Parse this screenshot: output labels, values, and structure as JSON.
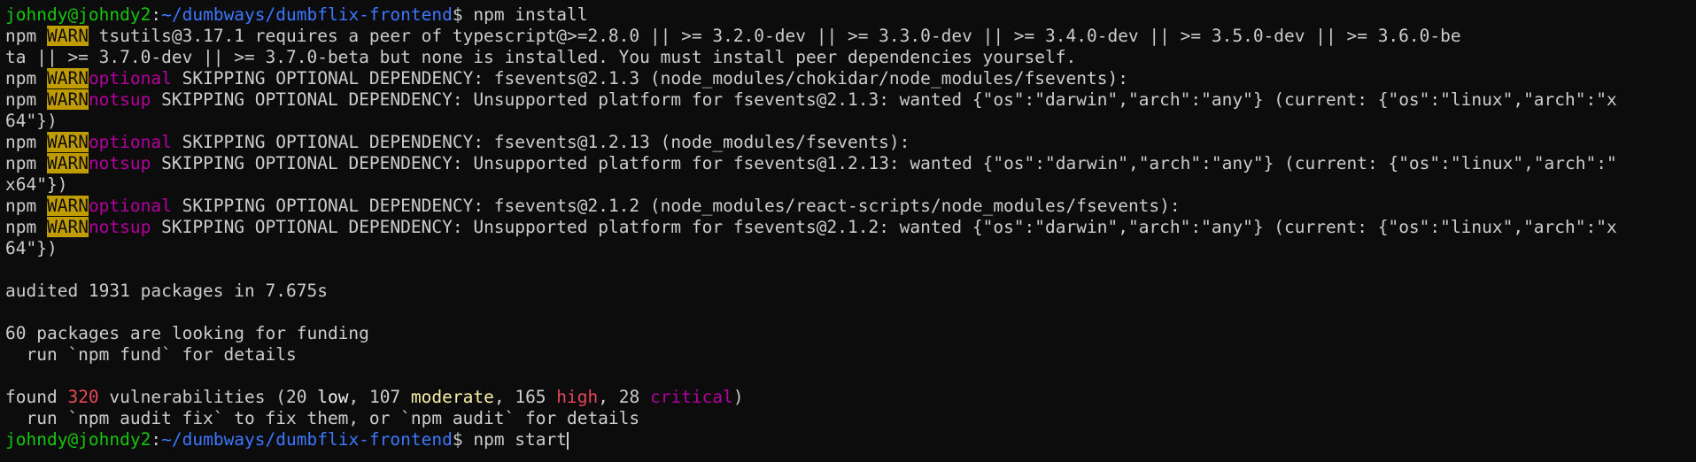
{
  "colors": {
    "background": "#0c0c0c",
    "foreground": "#cccccc",
    "prompt_user": "#16c60c",
    "prompt_path": "#3b78ff",
    "warn_badge_bg": "#c19c00",
    "warn_badge_fg": "#0c0c0c",
    "magenta": "#b4009e",
    "red": "#e74856",
    "yellow": "#f9f1a5"
  },
  "prompt": {
    "user_host": "johndy@johndy2",
    "sep": ":",
    "path": "~/dumbways/dumbflix-frontend",
    "symbol": "$ "
  },
  "commands": {
    "install": "npm install",
    "start": "npm start"
  },
  "npm_label": "npm ",
  "warn_label": "WARN",
  "peer_warn": {
    "line1": " tsutils@3.17.1 requires a peer of typescript@>=2.8.0 || >= 3.2.0-dev || >= 3.3.0-dev || >= 3.4.0-dev || >= 3.5.0-dev || >= 3.6.0-be",
    "line2": "ta || >= 3.7.0-dev || >= 3.7.0-beta but none is installed. You must install peer dependencies yourself."
  },
  "warnings": [
    {
      "kind": "optional",
      "text": " SKIPPING OPTIONAL DEPENDENCY: fsevents@2.1.3 (node_modules/chokidar/node_modules/fsevents):",
      "wrap": ""
    },
    {
      "kind": "notsup",
      "text": " SKIPPING OPTIONAL DEPENDENCY: Unsupported platform for fsevents@2.1.3: wanted {\"os\":\"darwin\",\"arch\":\"any\"} (current: {\"os\":\"linux\",\"arch\":\"x",
      "wrap": "64\"})"
    },
    {
      "kind": "optional",
      "text": " SKIPPING OPTIONAL DEPENDENCY: fsevents@1.2.13 (node_modules/fsevents):",
      "wrap": ""
    },
    {
      "kind": "notsup",
      "text": " SKIPPING OPTIONAL DEPENDENCY: Unsupported platform for fsevents@1.2.13: wanted {\"os\":\"darwin\",\"arch\":\"any\"} (current: {\"os\":\"linux\",\"arch\":\"",
      "wrap": "x64\"})"
    },
    {
      "kind": "optional",
      "text": " SKIPPING OPTIONAL DEPENDENCY: fsevents@2.1.2 (node_modules/react-scripts/node_modules/fsevents):",
      "wrap": ""
    },
    {
      "kind": "notsup",
      "text": " SKIPPING OPTIONAL DEPENDENCY: Unsupported platform for fsevents@2.1.2: wanted {\"os\":\"darwin\",\"arch\":\"any\"} (current: {\"os\":\"linux\",\"arch\":\"x",
      "wrap": "64\"})"
    }
  ],
  "audited": "audited 1931 packages in 7.675s",
  "funding": {
    "line1": "60 packages are looking for funding",
    "line2": "  run `npm fund` for details"
  },
  "vulnerabilities": {
    "prefix": "found ",
    "total": "320",
    "mid1": " vulnerabilities (20 ",
    "low": "low",
    "mid2": ", 107 ",
    "moderate": "moderate",
    "mid3": ", 165 ",
    "high": "high",
    "mid4": ", 28 ",
    "critical": "critical",
    "suffix": ")",
    "fix_hint": "  run `npm audit fix` to fix them, or `npm audit` for details"
  }
}
